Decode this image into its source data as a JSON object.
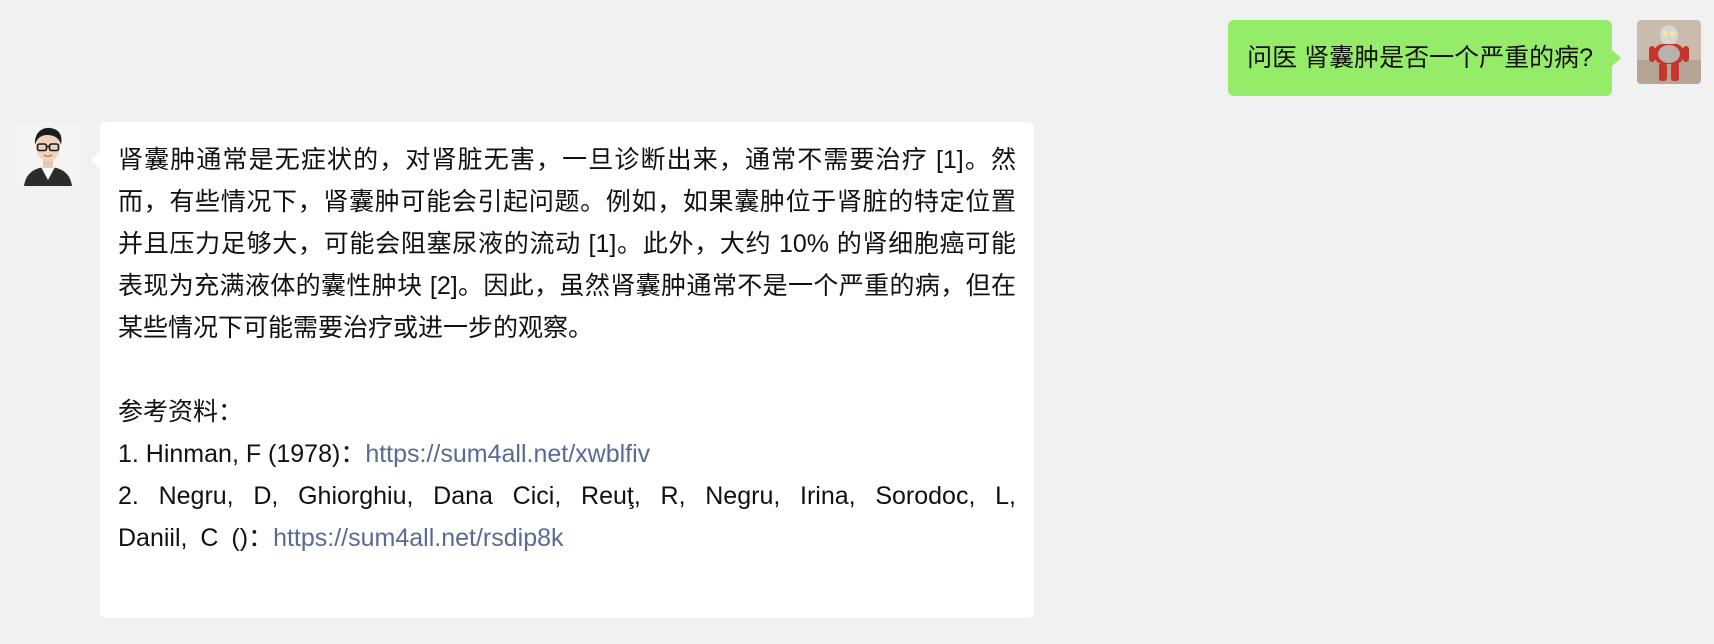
{
  "messages": {
    "outgoing": {
      "text": "问医 肾囊肿是否一个严重的病?"
    },
    "incoming": {
      "body": "肾囊肿通常是无症状的，对肾脏无害，一旦诊断出来，通常不需要治疗 [1]。然而，有些情况下，肾囊肿可能会引起问题。例如，如果囊肿位于肾脏的特定位置并且压力足够大，可能会阻塞尿液的流动 [1]。此外，大约 10% 的肾细胞癌可能表现为充满液体的囊性肿块 [2]。因此，虽然肾囊肿通常不是一个严重的病，但在某些情况下可能需要治疗或进一步的观察。",
      "references_heading": "参考资料：",
      "references": [
        {
          "text": "1. Hinman,  F (1978)：",
          "link": "https://sum4all.net/xwblfiv"
        },
        {
          "text": "2. Negru,  D,  Ghiorghiu,  Dana Cici,  Reuţ,  R,  Negru,  Irina,  Sorodoc,  L,  Daniil,  C ()：",
          "link": "https://sum4all.net/rsdip8k"
        }
      ]
    }
  },
  "colors": {
    "background": "#f1f1f1",
    "outgoing_bubble": "#95ec69",
    "incoming_bubble": "#ffffff",
    "link": "#576b95"
  },
  "icons": {
    "user_avatar": "figurine-avatar-icon",
    "bot_avatar": "doctor-avatar-icon"
  }
}
